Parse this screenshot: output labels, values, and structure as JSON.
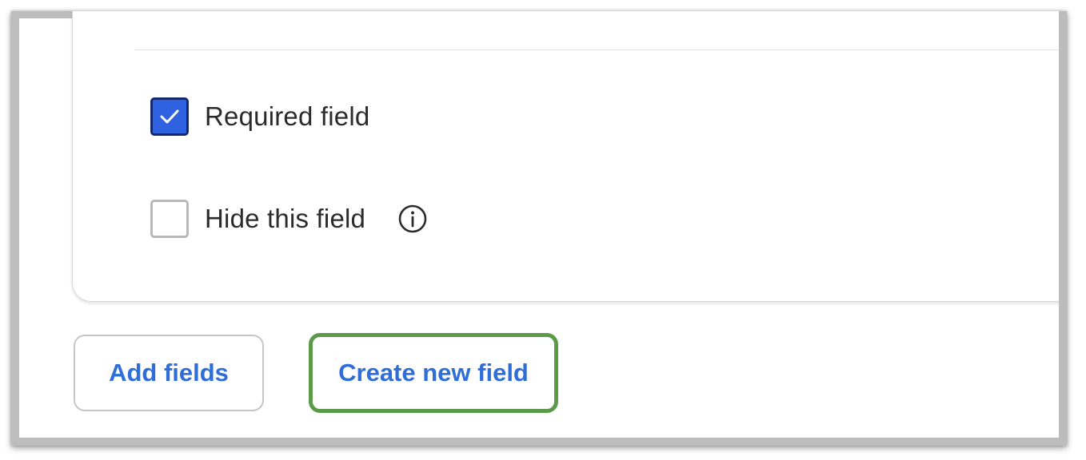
{
  "form": {
    "required": {
      "label": "Required field",
      "checked": true
    },
    "hide": {
      "label": "Hide this field",
      "checked": false
    }
  },
  "actions": {
    "add_label": "Add fields",
    "create_label": "Create new field",
    "highlight_color": "#5b9a48"
  },
  "colors": {
    "link": "#2f6ed8",
    "checkbox_checked": "#2f62e0",
    "checkbox_border": "#14286e"
  },
  "icons": {
    "info": "info-circle-icon",
    "check": "checkmark-icon"
  }
}
